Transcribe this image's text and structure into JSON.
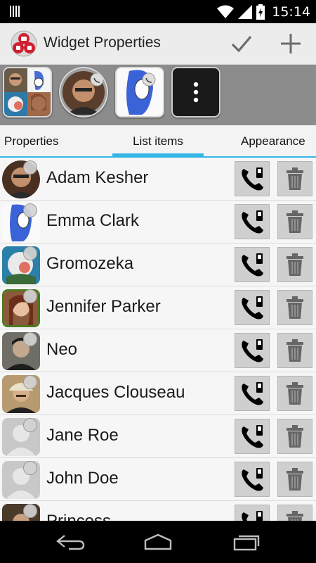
{
  "status_bar": {
    "time": "15:14",
    "icons": [
      "barcode-icon",
      "wifi-icon",
      "signal-icon",
      "battery-charging-icon"
    ]
  },
  "action_bar": {
    "title": "Widget Properties",
    "actions": [
      "check-icon",
      "add-icon"
    ]
  },
  "widget_strip": {
    "tiles": [
      "group-collage",
      "adam-kesher",
      "emma-clark",
      "more-menu"
    ]
  },
  "tabs": [
    {
      "label": "Properties"
    },
    {
      "label": "List items",
      "selected": true
    },
    {
      "label": "Appearance"
    }
  ],
  "list_items": [
    {
      "name": "Adam Kesher"
    },
    {
      "name": "Emma Clark"
    },
    {
      "name": "Gromozeka"
    },
    {
      "name": "Jennifer Parker"
    },
    {
      "name": "Neo"
    },
    {
      "name": "Jacques Clouseau"
    },
    {
      "name": "Jane Roe"
    },
    {
      "name": "John Doe"
    },
    {
      "name": "Princess"
    }
  ],
  "colors": {
    "accent": "#35b5e5",
    "status_bar": "#000000",
    "action_bar": "#ececec",
    "strip": "#8c8c8c"
  }
}
